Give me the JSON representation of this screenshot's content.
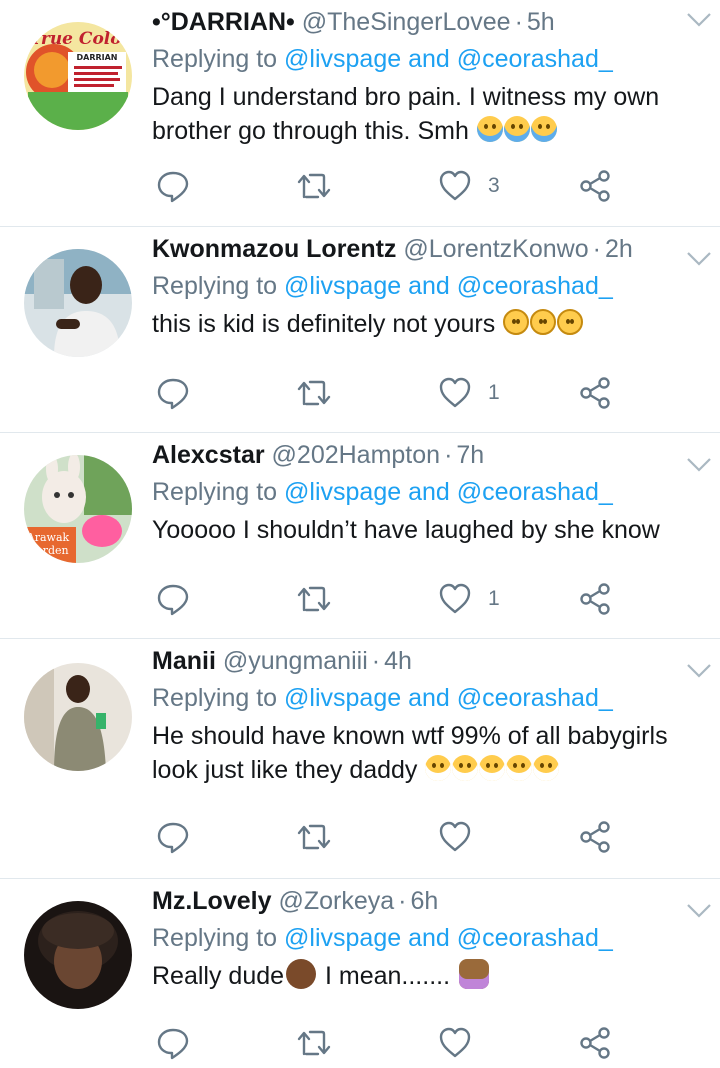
{
  "colors": {
    "link": "#1da1f2",
    "muted": "#657786",
    "text": "#14171a",
    "divider": "#e1e8ed"
  },
  "tweets": [
    {
      "name": "•°DARRIAN•",
      "handle": "@TheSingerLovee",
      "time": "5h",
      "replying_prefix": "Replying to ",
      "replying_to": "@livspage and @ceorashad_",
      "text": "Dang I understand bro pain. I witness my own brother go through this. Smh ",
      "emojis": [
        "crying-emoji",
        "crying-emoji",
        "crying-emoji"
      ],
      "likes": "3",
      "avatar_text": [
        "True Color",
        "DARRIAN"
      ]
    },
    {
      "name": "Kwonmazou Lorentz",
      "handle": "@LorentzKonwo",
      "time": "2h",
      "replying_prefix": "Replying to ",
      "replying_to": "@livspage and @ceorashad_",
      "text": "this is kid is definitely not yours ",
      "emojis": [
        "slight-smile-emoji",
        "slight-smile-emoji",
        "slight-smile-emoji"
      ],
      "likes": "1"
    },
    {
      "name": "Alexcstar",
      "handle": "@202Hampton",
      "time": "7h",
      "replying_prefix": "Replying to ",
      "replying_to": "@livspage and @ceorashad_",
      "text": "Yooooo I shouldn’t have laughed by she know",
      "likes": "1",
      "avatar_text": [
        "Arawak",
        "Garden"
      ]
    },
    {
      "name": "Manii",
      "handle": "@yungmaniii",
      "time": "4h",
      "replying_prefix": "Replying to ",
      "replying_to": "@livspage and @ceorashad_",
      "text_line1": "He should have known wtf 99% of all babygirls",
      "text_line2": "look just like they daddy ",
      "emojis": [
        "sweat-smile-emoji",
        "sweat-smile-emoji",
        "sweat-smile-emoji",
        "sweat-smile-emoji",
        "sweat-smile-emoji"
      ],
      "likes": ""
    },
    {
      "name": "Mz.Lovely",
      "handle": "@Zorkeya",
      "time": "6h",
      "replying_prefix": "Replying to ",
      "replying_to": "@livspage and @ceorashad_",
      "text_a": "Really dude",
      "text_b": " I mean....... ",
      "likes": ""
    }
  ]
}
